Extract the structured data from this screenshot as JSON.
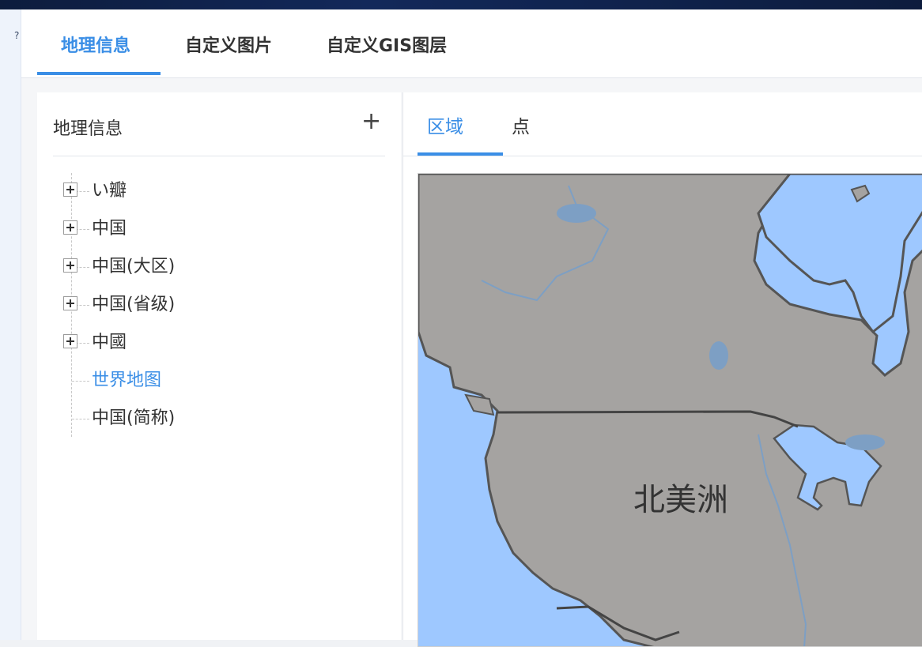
{
  "top_tabs": [
    {
      "label": "地理信息",
      "active": true
    },
    {
      "label": "自定义图片",
      "active": false
    },
    {
      "label": "自定义GIS图层",
      "active": false
    }
  ],
  "left_panel": {
    "title": "地理信息",
    "add_icon": "plus-icon",
    "tree": [
      {
        "label": "い瓣",
        "expandable": true,
        "selected": false
      },
      {
        "label": "中国",
        "expandable": true,
        "selected": false
      },
      {
        "label": "中国(大区)",
        "expandable": true,
        "selected": false
      },
      {
        "label": "中国(省级)",
        "expandable": true,
        "selected": false
      },
      {
        "label": "中國",
        "expandable": true,
        "selected": false
      },
      {
        "label": "世界地图",
        "expandable": false,
        "selected": true
      },
      {
        "label": "中国(简称)",
        "expandable": false,
        "selected": false
      }
    ]
  },
  "right_panel": {
    "sub_tabs": [
      {
        "label": "区域",
        "active": true
      },
      {
        "label": "点",
        "active": false
      }
    ],
    "map": {
      "region_label": "北美洲",
      "land_color": "#a5a3a1",
      "water_color": "#9ec8ff",
      "border_color": "#555555"
    }
  },
  "colors": {
    "accent": "#3a8ee6",
    "text": "#333333"
  }
}
